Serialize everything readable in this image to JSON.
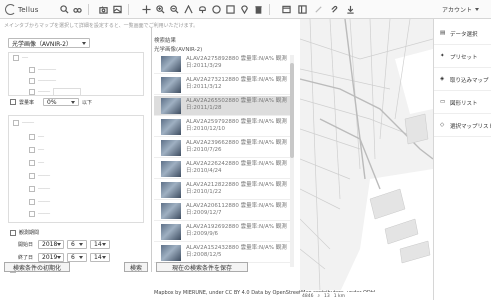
{
  "app": {
    "logo_text": "Tellus"
  },
  "toolbar": {
    "icons": [
      "search-icon",
      "binoculars-icon",
      "camera-icon",
      "image-icon",
      "move-icon",
      "zoom-in-icon",
      "zoom-out-icon",
      "measure-icon",
      "balloon-icon",
      "circle-icon",
      "square-icon",
      "pin-icon",
      "trash-icon",
      "window-icon",
      "layout-icon",
      "link-icon",
      "clip-icon",
      "download-icon"
    ],
    "account_label": "アカウント"
  },
  "search_panel": {
    "hint": "メインタブからマップを選択して詳細を設定すると、一覧画面でご利用いただけます。",
    "sensor_select": "光学画像（AVNIR-2）",
    "cloud_label": "雲量率",
    "cloud_value": "0%",
    "cloud_suffix": "以下",
    "period_label": "観測期間",
    "start_label": "開始日",
    "start_year": "2018",
    "start_month": "6",
    "start_day": "14",
    "end_label": "終了日",
    "end_year": "2019",
    "end_month": "6",
    "end_day": "14",
    "reset_button": "検索条件の初期化",
    "search_button": "検索"
  },
  "results": {
    "title": "検索結果",
    "subtitle": "光学画像(AVNIR-2)",
    "items": [
      {
        "id": "ALAV2A275892880",
        "cloud": "雲量率:N/A%",
        "note": "観測",
        "date": "日:2011/3/29",
        "selected": false
      },
      {
        "id": "ALAV2A273212880",
        "cloud": "雲量率:N/A%",
        "note": "観測",
        "date": "日:2011/3/12",
        "selected": false
      },
      {
        "id": "ALAV2A265502880",
        "cloud": "雲量率:N/A%",
        "note": "観測",
        "date": "日:2011/1/28",
        "selected": true
      },
      {
        "id": "ALAV2A259792880",
        "cloud": "雲量率:N/A%",
        "note": "観測",
        "date": "日:2010/12/10",
        "selected": false
      },
      {
        "id": "ALAV2A239662880",
        "cloud": "雲量率:N/A%",
        "note": "観測",
        "date": "日:2010/7/26",
        "selected": false
      },
      {
        "id": "ALAV2A226242880",
        "cloud": "雲量率:N/A%",
        "note": "観測",
        "date": "日:2010/4/24",
        "selected": false
      },
      {
        "id": "ALAV2A212822880",
        "cloud": "雲量率:N/A%",
        "note": "観測",
        "date": "日:2010/1/22",
        "selected": false
      },
      {
        "id": "ALAV2A206112880",
        "cloud": "雲量率:N/A%",
        "note": "観測",
        "date": "日:2009/12/7",
        "selected": false
      },
      {
        "id": "ALAV2A192692880",
        "cloud": "雲量率:N/A%",
        "note": "観測",
        "date": "日:2009/9/6",
        "selected": false
      },
      {
        "id": "ALAV2A152432880",
        "cloud": "雲量率:N/A%",
        "note": "観測",
        "date": "日:2008/12/5",
        "selected": false
      }
    ],
    "save_button": "現在の検索条件を保存"
  },
  "map": {
    "attribution": "Mapbox by MIERUNE, under CC BY 4.0 Data by OpenStreetMap contributors, under ODbL.",
    "coords": "4846",
    "zoom": "13",
    "scale": "1 km"
  },
  "right_panel": {
    "items": [
      {
        "label": "データ選択",
        "icon": "data-icon"
      },
      {
        "label": "プリセット",
        "icon": "preset-icon"
      },
      {
        "label": "取り込みマップ",
        "icon": "layers-icon"
      },
      {
        "label": "図形リスト",
        "icon": "list-icon"
      },
      {
        "label": "選択マップリスト",
        "icon": "map-list-icon"
      }
    ]
  }
}
